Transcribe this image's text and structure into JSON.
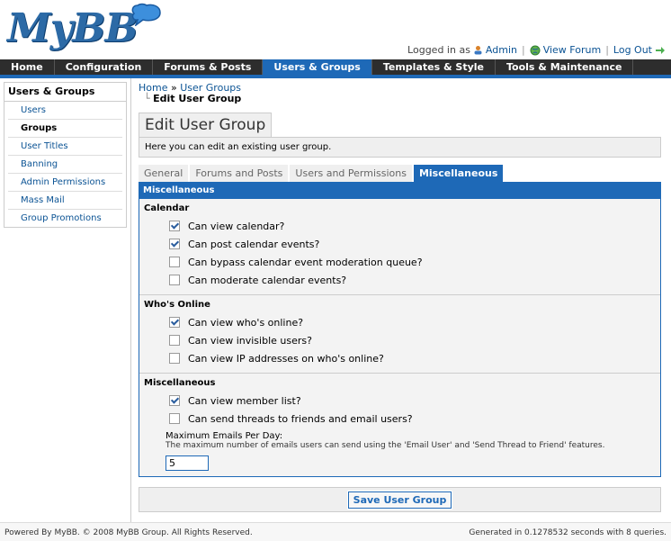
{
  "header": {
    "logo_text": "MyBB",
    "logged_in_as": "Logged in as",
    "admin_link": "Admin",
    "view_forum": "View Forum",
    "log_out": "Log Out"
  },
  "nav": {
    "tabs": [
      "Home",
      "Configuration",
      "Forums & Posts",
      "Users & Groups",
      "Templates & Style",
      "Tools & Maintenance"
    ],
    "active": "Users & Groups"
  },
  "sidebar": {
    "title": "Users & Groups",
    "items": [
      {
        "label": "Users"
      },
      {
        "label": "Groups"
      },
      {
        "label": "User Titles"
      },
      {
        "label": "Banning"
      },
      {
        "label": "Admin Permissions"
      },
      {
        "label": "Mass Mail"
      },
      {
        "label": "Group Promotions"
      }
    ],
    "active": "Groups"
  },
  "breadcrumb": {
    "home": "Home",
    "sep": " » ",
    "users_groups": "User Groups",
    "current": "Edit User Group"
  },
  "page": {
    "title": "Edit User Group",
    "description": "Here you can edit an existing user group."
  },
  "tabs": [
    "General",
    "Forums and Posts",
    "Users and Permissions",
    "Miscellaneous"
  ],
  "active_tab": "Miscellaneous",
  "panel": {
    "header": "Miscellaneous",
    "groups": [
      {
        "title": "Calendar",
        "options": [
          {
            "label": "Can view calendar?",
            "checked": true
          },
          {
            "label": "Can post calendar events?",
            "checked": true
          },
          {
            "label": "Can bypass calendar event moderation queue?",
            "checked": false
          },
          {
            "label": "Can moderate calendar events?",
            "checked": false
          }
        ]
      },
      {
        "title": "Who's Online",
        "options": [
          {
            "label": "Can view who's online?",
            "checked": true
          },
          {
            "label": "Can view invisible users?",
            "checked": false
          },
          {
            "label": "Can view IP addresses on who's online?",
            "checked": false
          }
        ]
      },
      {
        "title": "Miscellaneous",
        "options": [
          {
            "label": "Can view member list?",
            "checked": true
          },
          {
            "label": "Can send threads to friends and email users?",
            "checked": false
          }
        ],
        "field": {
          "label": "Maximum Emails Per Day:",
          "description": "The maximum number of emails users can send using the 'Email User' and 'Send Thread to Friend' features.",
          "value": "5"
        }
      }
    ]
  },
  "save_label": "Save User Group",
  "footer": {
    "left": "Powered By MyBB. © 2008 MyBB Group. All Rights Reserved.",
    "right": "Generated in 0.1278532 seconds with 8 queries."
  },
  "colors": {
    "accent": "#1e69b7",
    "nav_bg": "#2d2d2d",
    "link": "#0b5394"
  }
}
